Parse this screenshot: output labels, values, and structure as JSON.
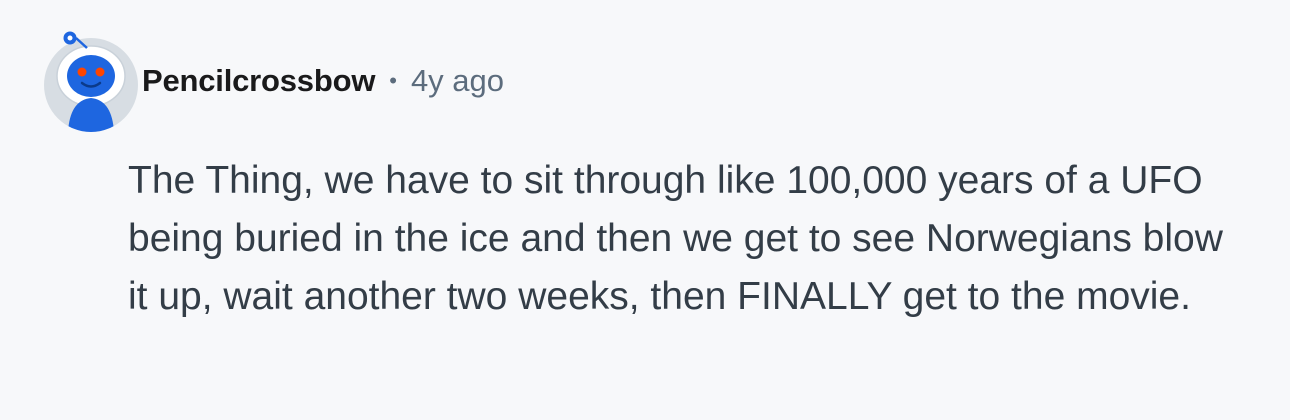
{
  "comment": {
    "avatar_icon": "snoo-avatar-icon",
    "username": "Pencilcrossbow",
    "separator": "•",
    "timestamp": "4y ago",
    "body": "The Thing, we have to sit through like 100,000 years of a UFO being buried in the ice and then we get to see Norwegians blow it up, wait another two weeks, then FINALLY get to the movie."
  },
  "colors": {
    "background": "#f7f8fa",
    "username": "#1a1a1b",
    "meta": "#5c6c7d",
    "body_text": "#333d47",
    "avatar_blue": "#1e66e0",
    "avatar_eye": "#ff4500"
  }
}
